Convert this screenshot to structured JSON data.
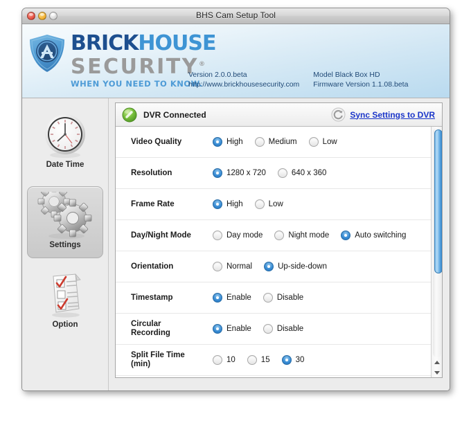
{
  "window": {
    "title": "BHS Cam Setup Tool",
    "traffic_lights": [
      "close",
      "minimize",
      "zoom"
    ]
  },
  "brand": {
    "name_part1": "BRICK",
    "name_part2": "HOUSE",
    "name_line2": "SECURITY",
    "registered_mark": "®",
    "tagline": "WHEN YOU NEED TO KNOW.",
    "logo_icon": "brickhouse-shield-icon",
    "colors": {
      "brick_blue": "#1d4f8f",
      "house_blue": "#3e94d4",
      "security_gray": "#9a9a9a",
      "tagline_blue": "#4e9bd6",
      "header_blue": "#b9daef"
    },
    "meta_left": [
      "Version 2.0.0.beta",
      "http://www.brickhousesecurity.com"
    ],
    "meta_right": [
      "Model Black Box HD",
      "Firmware Version 1.1.08.beta"
    ]
  },
  "sidebar": {
    "items": [
      {
        "label": "Date Time",
        "icon": "clock-icon",
        "selected": false
      },
      {
        "label": "Settings",
        "icon": "gears-icon",
        "selected": true
      },
      {
        "label": "Option",
        "icon": "checklist-icon",
        "selected": false
      }
    ]
  },
  "panel": {
    "status": {
      "led_icon": "green-status-led-icon",
      "led_color": "#6cb93b",
      "text": "DVR Connected",
      "sync_icon": "refresh-circle-icon",
      "sync_label": "Sync Settings to DVR",
      "sync_link_color": "#1a35c9"
    },
    "settings_rows": [
      {
        "label": "Video Quality",
        "options": [
          {
            "label": "High",
            "selected": true
          },
          {
            "label": "Medium",
            "selected": false
          },
          {
            "label": "Low",
            "selected": false
          }
        ]
      },
      {
        "label": "Resolution",
        "options": [
          {
            "label": "1280 x 720",
            "selected": true
          },
          {
            "label": "640 x 360",
            "selected": false
          }
        ]
      },
      {
        "label": "Frame Rate",
        "options": [
          {
            "label": "High",
            "selected": true
          },
          {
            "label": "Low",
            "selected": false
          }
        ]
      },
      {
        "label": "Day/Night Mode",
        "options": [
          {
            "label": "Day mode",
            "selected": false
          },
          {
            "label": "Night mode",
            "selected": false
          },
          {
            "label": "Auto switching",
            "selected": true
          }
        ]
      },
      {
        "label": "Orientation",
        "options": [
          {
            "label": "Normal",
            "selected": false
          },
          {
            "label": "Up-side-down",
            "selected": true
          }
        ]
      },
      {
        "label": "Timestamp",
        "options": [
          {
            "label": "Enable",
            "selected": true
          },
          {
            "label": "Disable",
            "selected": false
          }
        ]
      },
      {
        "label": "Circular Recording",
        "label_lines": [
          "Circular",
          "Recording"
        ],
        "options": [
          {
            "label": "Enable",
            "selected": true
          },
          {
            "label": "Disable",
            "selected": false
          }
        ]
      },
      {
        "label": "Split File Time (min)",
        "label_lines": [
          "Split File Time",
          "(min)"
        ],
        "options": [
          {
            "label": "10",
            "selected": false
          },
          {
            "label": "15",
            "selected": false
          },
          {
            "label": "30",
            "selected": true
          }
        ]
      }
    ],
    "scrollbar": {
      "orientation": "vertical",
      "thumb_color": "#5ea8e2",
      "up_arrow_icon": "triangle-up-icon",
      "down_arrow_icon": "triangle-down-icon"
    }
  }
}
